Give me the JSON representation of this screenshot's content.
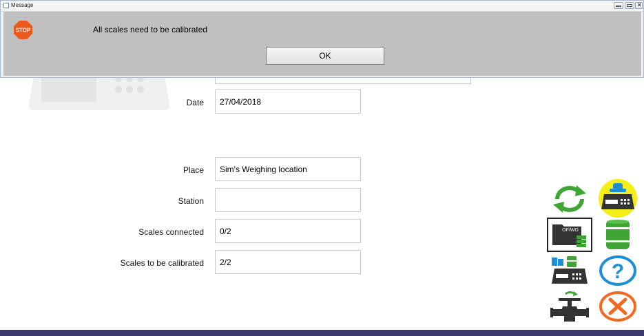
{
  "dialog": {
    "title": "Message",
    "icon": "stop-icon",
    "icon_text": "STOP",
    "message": "All scales need to be calibrated",
    "ok_label": "OK",
    "close_glyph": "✕"
  },
  "form": {
    "date_label": "Date",
    "date_value": "27/04/2018",
    "place_label": "Place",
    "place_value": "Sim's Weighing location",
    "station_label": "Station",
    "station_value": "",
    "scales_connected_label": "Scales connected",
    "scales_connected_value": "0/2",
    "scales_calibrate_label": "Scales to be calibrated",
    "scales_calibrate_value": "2/2"
  },
  "toolbar": {
    "tools": [
      "refresh-icon",
      "scale-highlighted-icon",
      "folder-of-wo-icon",
      "barrel-icon",
      "scale-with-containers-icon",
      "help-icon",
      "valve-icon",
      "cancel-icon"
    ],
    "folder_text": "OF/WO",
    "help_glyph": "?"
  },
  "colors": {
    "accent_green": "#3fa535",
    "help_blue": "#1e8fd6",
    "cancel_orange": "#f26a21",
    "highlight_yellow": "#f4ef1a",
    "bottom_bar": "#3c3870",
    "dialog_body": "#c0c0c0"
  }
}
